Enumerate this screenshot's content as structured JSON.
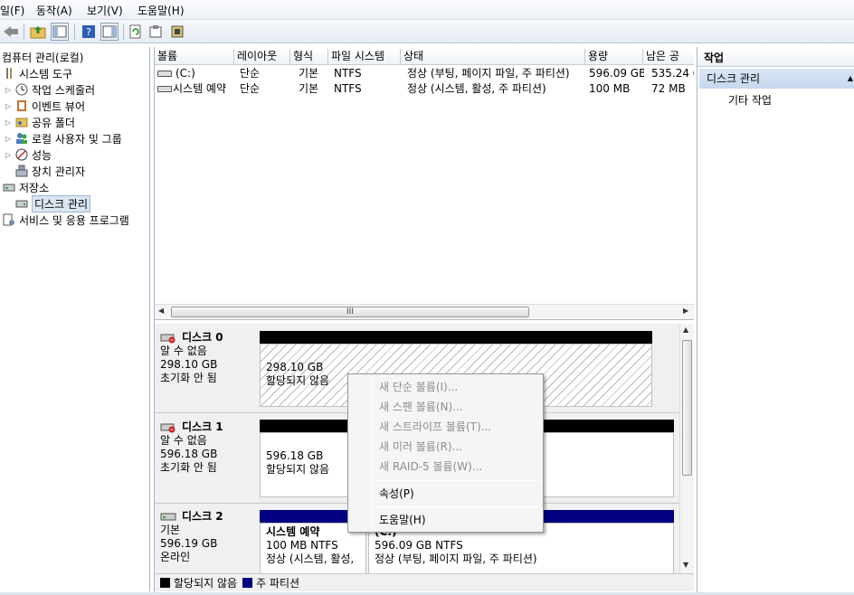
{
  "menu": {
    "items": [
      "일(F)",
      "동작(A)",
      "보기(V)",
      "도움말(H)"
    ]
  },
  "toolbar": {
    "icons": [
      "back-arrow-icon",
      "up-folder-icon",
      "show-hide-tree-icon",
      "help-icon",
      "panel-icon",
      "refresh-icon",
      "properties-icon",
      "disk-icon"
    ]
  },
  "tree": {
    "items": [
      {
        "label": "컴퓨터 관리(로컬)",
        "icon": "computer-icon"
      },
      {
        "label": "시스템 도구",
        "icon": "tools-icon"
      },
      {
        "label": "작업 스케줄러",
        "icon": "clock-icon"
      },
      {
        "label": "이벤트 뷰어",
        "icon": "event-viewer-icon"
      },
      {
        "label": "공유 폴더",
        "icon": "shared-folder-icon"
      },
      {
        "label": "로컬 사용자 및 그룹",
        "icon": "users-icon"
      },
      {
        "label": "성능",
        "icon": "performance-icon"
      },
      {
        "label": "장치 관리자",
        "icon": "device-manager-icon"
      },
      {
        "label": "저장소",
        "icon": "storage-icon"
      },
      {
        "label": "디스크 관리",
        "icon": "disk-management-icon"
      },
      {
        "label": "서비스 및 응용 프로그램",
        "icon": "services-icon"
      }
    ]
  },
  "volumes": {
    "columns": [
      "볼륨",
      "레이아웃",
      "형식",
      "파일 시스템",
      "상태",
      "용량",
      "남은 공"
    ],
    "rows": [
      {
        "name": "(C:)",
        "layout": "단순",
        "type": "기본",
        "fs": "NTFS",
        "status": "정상 (부팅, 페이지 파일, 주 파티션)",
        "capacity": "596.09 GB",
        "free": "535.24 G"
      },
      {
        "name": "시스템 예약",
        "layout": "단순",
        "type": "기본",
        "fs": "NTFS",
        "status": "정상 (시스템, 활성, 주 파티션)",
        "capacity": "100 MB",
        "free": "72 MB"
      }
    ],
    "scroll_thumb": "III"
  },
  "disks": {
    "disk0": {
      "name": "디스크 0",
      "line1": "알 수 없음",
      "line2": "298.10 GB",
      "line3": "초기화 안 됨",
      "part_size": "298.10 GB",
      "part_status": "할당되지 않음"
    },
    "disk1": {
      "name": "디스크 1",
      "line1": "알 수 없음",
      "line2": "596.18 GB",
      "line3": "초기화 안 됨",
      "part_size": "596.18 GB",
      "part_status": "할당되지 않음"
    },
    "disk2": {
      "name": "디스크 2",
      "line1": "기본",
      "line2": "596.19 GB",
      "line3": "온라인",
      "part1_title": "시스템 예약",
      "part1_size": "100 MB NTFS",
      "part1_status": "정상 (시스템, 활성,",
      "part2_title": "(C:)",
      "part2_size": "596.09 GB NTFS",
      "part2_status": "정상 (부팅, 페이지 파일, 주 파티션)"
    }
  },
  "legend": {
    "unallocated": "할당되지 않음",
    "primary": "주 파티션",
    "unallocated_color": "#000000",
    "primary_color": "#000080"
  },
  "actions": {
    "title": "작업",
    "section": "디스크 관리",
    "item": "기타 작업"
  },
  "context_menu": {
    "items": [
      {
        "label": "새 단순 볼륨(I)...",
        "enabled": false
      },
      {
        "label": "새 스팬 볼륨(N)...",
        "enabled": false
      },
      {
        "label": "새 스트라이프 볼륨(T)...",
        "enabled": false
      },
      {
        "label": "새 미러 볼륨(R)...",
        "enabled": false
      },
      {
        "label": "새 RAID-5 볼륨(W)...",
        "enabled": false
      },
      {
        "label": "속성(P)",
        "enabled": true
      },
      {
        "label": "도움말(H)",
        "enabled": true
      }
    ]
  }
}
